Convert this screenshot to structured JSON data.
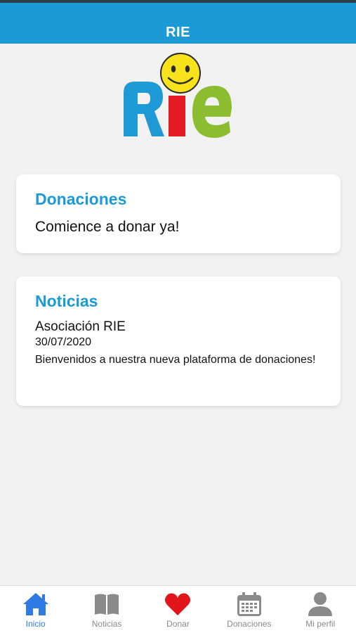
{
  "header": {
    "title": "RIE"
  },
  "logo": {
    "text": "RIE"
  },
  "cards": {
    "donaciones": {
      "title": "Donaciones",
      "text": "Comience a donar ya!"
    },
    "noticias": {
      "title": "Noticias",
      "source": "Asociación RIE",
      "date": "30/07/2020",
      "body": "Bienvenidos a nuestra nueva plataforma de donaciones!"
    }
  },
  "tabbar": {
    "items": [
      {
        "label": "Inicio",
        "icon": "home-icon",
        "active": true
      },
      {
        "label": "Noticias",
        "icon": "book-icon",
        "active": false
      },
      {
        "label": "Donar",
        "icon": "heart-icon",
        "active": false
      },
      {
        "label": "Donaciones",
        "icon": "calendar-icon",
        "active": false
      },
      {
        "label": "Mi perfil",
        "icon": "user-icon",
        "active": false
      }
    ]
  },
  "colors": {
    "header": "#1c9ad6",
    "accent_title": "#1c9ad6",
    "tab_active": "#2d7be3",
    "tab_inactive": "#8a8a8a",
    "heart": "#e0161b",
    "logo_r": "#1e9ad6",
    "logo_i": "#e31b23",
    "logo_e": "#8cbc2f",
    "smiley": "#f7e21b"
  }
}
